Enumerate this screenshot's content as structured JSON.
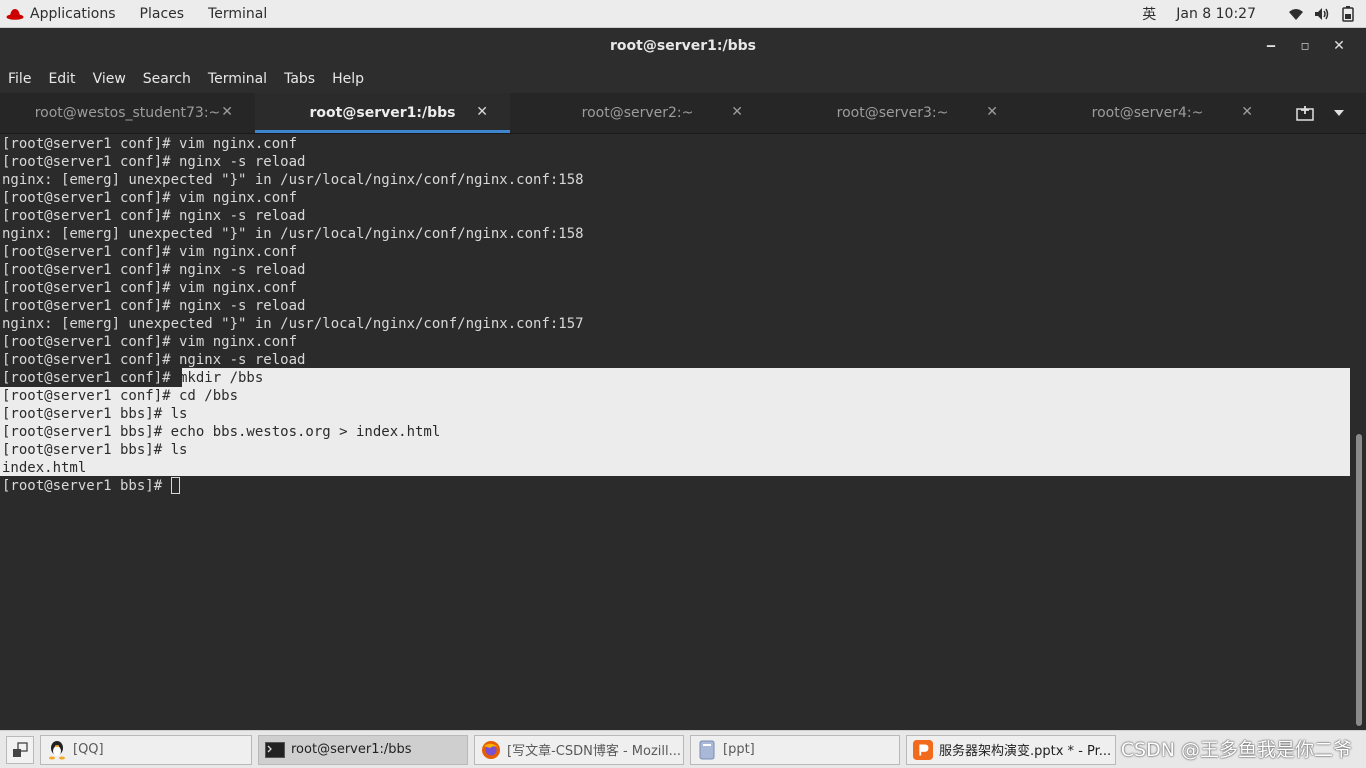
{
  "topbar": {
    "applications": "Applications",
    "places": "Places",
    "terminal": "Terminal",
    "ime": "英",
    "clock": "Jan 8  10:27"
  },
  "window": {
    "title": "root@server1:/bbs",
    "minimize": "‒",
    "maximize": "◻",
    "close": "✕"
  },
  "menu": [
    "File",
    "Edit",
    "View",
    "Search",
    "Terminal",
    "Tabs",
    "Help"
  ],
  "tabs": [
    {
      "label": "root@westos_student73:~",
      "close": "✕"
    },
    {
      "label": "root@server1:/bbs",
      "close": "✕"
    },
    {
      "label": "root@server2:~",
      "close": "✕"
    },
    {
      "label": "root@server3:~",
      "close": "✕"
    },
    {
      "label": "root@server4:~",
      "close": "✕"
    }
  ],
  "terminal": {
    "lines": [
      "[root@server1 conf]# vim nginx.conf",
      "[root@server1 conf]# nginx -s reload",
      "nginx: [emerg] unexpected \"}\" in /usr/local/nginx/conf/nginx.conf:158",
      "[root@server1 conf]# vim nginx.conf",
      "[root@server1 conf]# nginx -s reload",
      "nginx: [emerg] unexpected \"}\" in /usr/local/nginx/conf/nginx.conf:158",
      "[root@server1 conf]# vim nginx.conf",
      "[root@server1 conf]# nginx -s reload",
      "[root@server1 conf]# vim nginx.conf",
      "[root@server1 conf]# nginx -s reload",
      "nginx: [emerg] unexpected \"}\" in /usr/local/nginx/conf/nginx.conf:157",
      "[root@server1 conf]# vim nginx.conf",
      "[root@server1 conf]# nginx -s reload",
      "[root@server1 conf]# mkdir /bbs",
      "[root@server1 conf]# cd /bbs",
      "[root@server1 bbs]# ls",
      "[root@server1 bbs]# echo bbs.westos.org > index.html",
      "[root@server1 bbs]# ls",
      "index.html"
    ],
    "prompt": "[root@server1 bbs]# "
  },
  "taskbar": {
    "items": [
      {
        "label": "[QQ]"
      },
      {
        "label": "root@server1:/bbs"
      },
      {
        "label": "[写文章-CSDN博客 - Mozill..."
      },
      {
        "label": "[ppt]"
      },
      {
        "label": "服务器架构演变.pptx * - Pr..."
      }
    ],
    "watermark": "CSDN @王多鱼我是你二爷"
  },
  "colors": {
    "accent": "#3f86d1",
    "terminal_bg": "#2b2b2b",
    "terminal_fg": "#d8d8d8",
    "selection_bg": "#ececec"
  }
}
